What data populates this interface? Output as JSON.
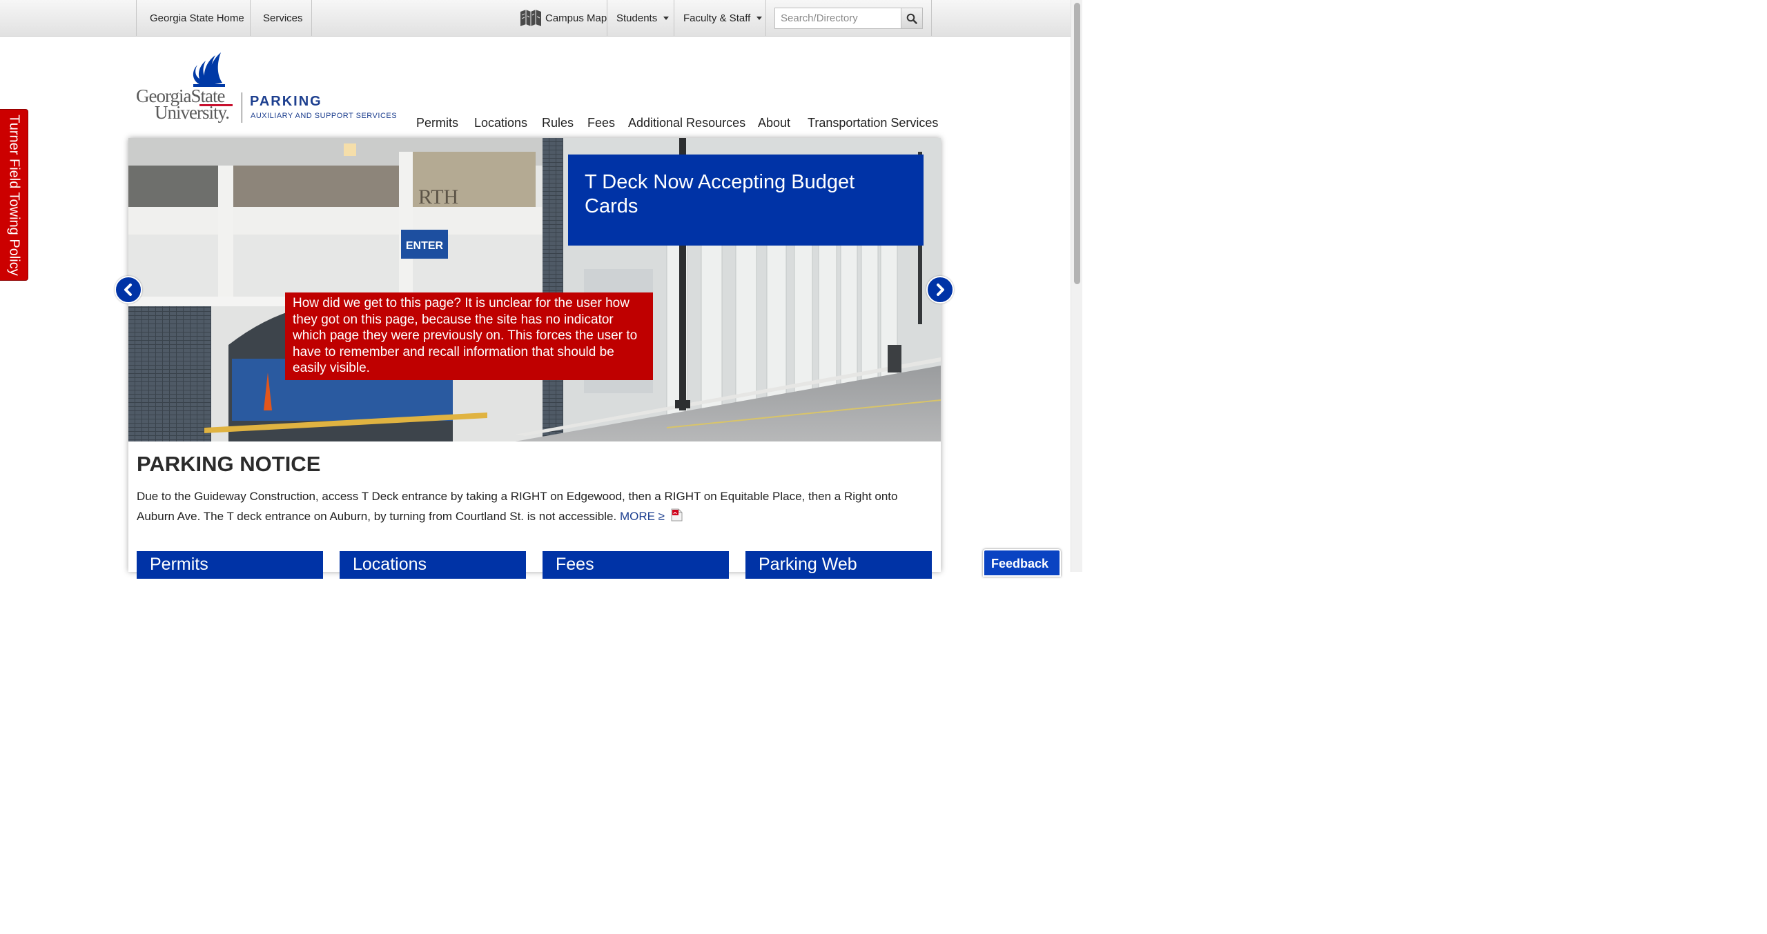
{
  "topbar": {
    "home": "Georgia State Home",
    "services": "Services",
    "campus_map": "Campus Map",
    "students": "Students",
    "faculty_staff": "Faculty & Staff",
    "search_placeholder": "Search/Directory"
  },
  "logo": {
    "gsu_line1": "GeorgiaState",
    "gsu_line2": "University.",
    "parking": "PARKING",
    "subtitle": "AUXILIARY AND SUPPORT SERVICES"
  },
  "nav": {
    "items": [
      "Permits",
      "Locations",
      "Rules",
      "Fees",
      "Additional Resources",
      "About",
      "Transportation Services"
    ]
  },
  "side_tab": {
    "label": "Turner Field Towing Policy"
  },
  "hero": {
    "banner": "T Deck Now Accepting Budget Cards",
    "sign_enter": "ENTER",
    "annotation": "How did we get to this page? It is unclear for the user how they got on this page, because the site has no indicator which page they were previously on. This forces the user to have to remember and recall information that should be easily visible."
  },
  "notice": {
    "title": "PARKING NOTICE",
    "body": "Due to the Guideway Construction, access T Deck entrance by taking a RIGHT on Edgewood, then a RIGHT on Equitable Place, then a Right onto Auburn Ave. The T deck entrance on Auburn, by turning from Courtland St. is not accessible.",
    "more": "MORE ≥"
  },
  "cards": [
    "Permits",
    "Locations",
    "Fees",
    "Parking Web"
  ],
  "feedback": "Feedback",
  "colors": {
    "brand_blue": "#0033a6",
    "alert_red": "#cc0000",
    "annotation_red": "#bf0000"
  }
}
